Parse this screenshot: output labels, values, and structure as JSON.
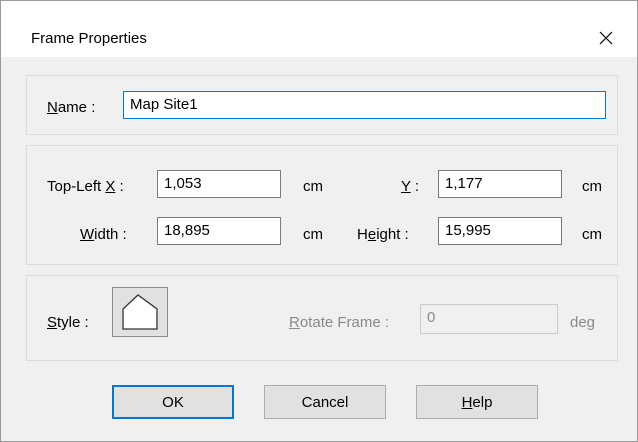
{
  "window": {
    "title": "Frame Properties",
    "close_icon": "close-icon"
  },
  "name_group": {
    "label_u": "N",
    "label_rest": "ame :",
    "value": "Map Site1"
  },
  "position_group": {
    "topleft_x": {
      "label_pre": "Top-Left ",
      "label_u": "X",
      "label_post": " :",
      "value": "1,053",
      "unit": "cm"
    },
    "topleft_y": {
      "label_u": "Y",
      "label_post": " :",
      "value": "1,177",
      "unit": "cm"
    },
    "width": {
      "label_u": "W",
      "label_post": "idth :",
      "value": "18,895",
      "unit": "cm"
    },
    "height": {
      "label_pre": "H",
      "label_u": "e",
      "label_post": "ight :",
      "value": "15,995",
      "unit": "cm"
    }
  },
  "style_group": {
    "style_label_u": "S",
    "style_label_rest": "tyle :",
    "style_icon": "frame-shape-icon",
    "rotate_label_u": "R",
    "rotate_label_rest": "otate Frame :",
    "rotate_value": "0",
    "rotate_unit": "deg"
  },
  "buttons": {
    "ok": "OK",
    "cancel": "Cancel",
    "help_u": "H",
    "help_rest": "elp"
  }
}
